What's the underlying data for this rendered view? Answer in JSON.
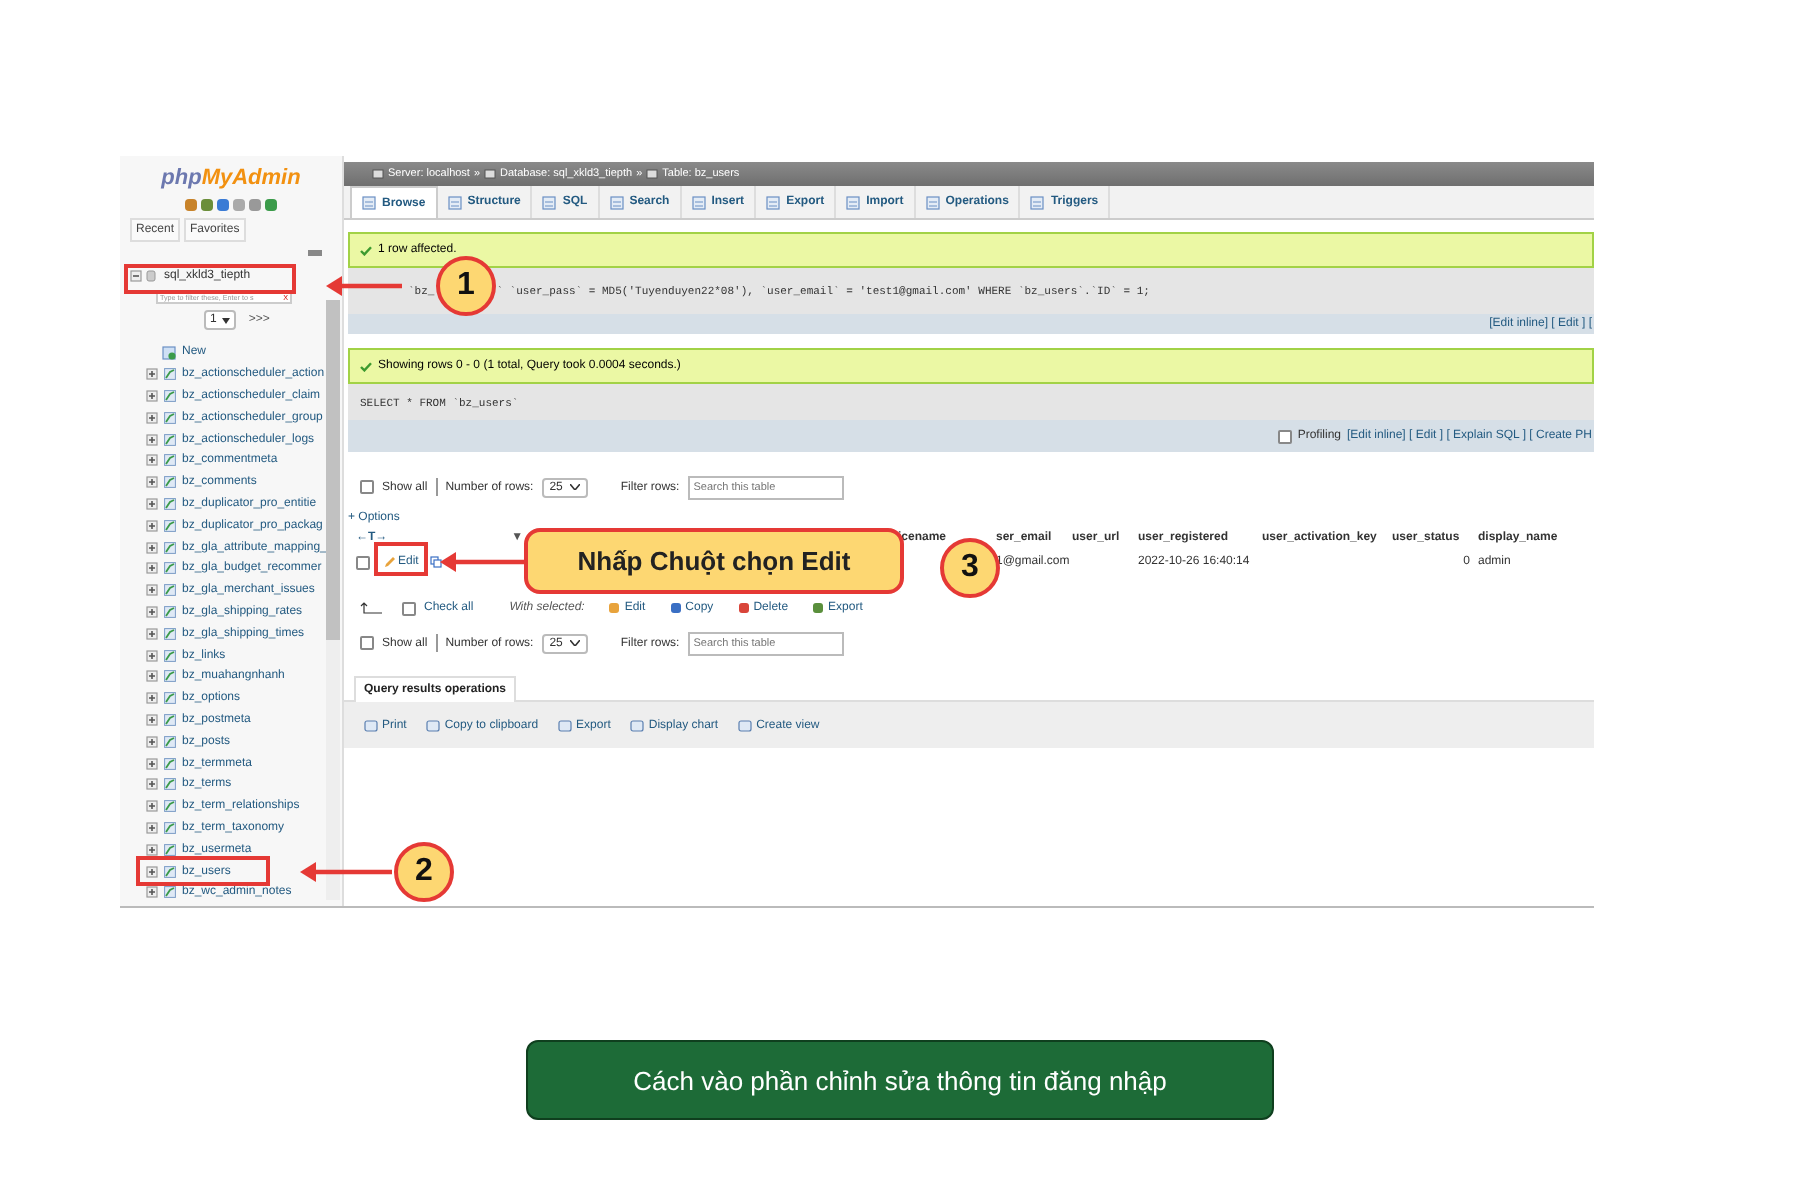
{
  "sidebar": {
    "logo": [
      "php",
      "MyAdmin"
    ],
    "tabs": [
      "Recent",
      "Favorites"
    ],
    "database": "sql_xkld3_tiepth",
    "filter_placeholder": "Type to filter these, Enter to s",
    "filter_clear": "X",
    "page": "1",
    "next": ">>>",
    "new_item": "New",
    "tables": [
      "bz_actionscheduler_action",
      "bz_actionscheduler_claim",
      "bz_actionscheduler_group",
      "bz_actionscheduler_logs",
      "bz_commentmeta",
      "bz_comments",
      "bz_duplicator_pro_entitie",
      "bz_duplicator_pro_packag",
      "bz_gla_attribute_mapping_",
      "bz_gla_budget_recommer",
      "bz_gla_merchant_issues",
      "bz_gla_shipping_rates",
      "bz_gla_shipping_times",
      "bz_links",
      "bz_muahangnhanh",
      "bz_options",
      "bz_postmeta",
      "bz_posts",
      "bz_termmeta",
      "bz_terms",
      "bz_term_relationships",
      "bz_term_taxonomy",
      "bz_usermeta",
      "bz_users",
      "bz_wc_admin_notes"
    ]
  },
  "breadcrumb": [
    {
      "text": "Server: localhost",
      "sep": "»"
    },
    {
      "text": "Database: sql_xkld3_tiepth",
      "sep": "»"
    },
    {
      "text": "Table: bz_users"
    }
  ],
  "tabs": [
    {
      "label": "Browse",
      "selected": true
    },
    {
      "label": "Structure",
      "selected": false
    },
    {
      "label": "SQL",
      "selected": false
    },
    {
      "label": "Search",
      "selected": false
    },
    {
      "label": "Insert",
      "selected": false
    },
    {
      "label": "Export",
      "selected": false
    },
    {
      "label": "Import",
      "selected": false
    },
    {
      "label": "Operations",
      "selected": false
    },
    {
      "label": "Triggers",
      "selected": false
    }
  ],
  "update_result": {
    "message": "1 row affected.",
    "sql_parts": [
      "`bz_",
      "` `user_pass` = MD5('Tuyenduyen22*08'), `user_email` = 'test1@gmail.com' WHERE `bz_users`.`ID` = 1;"
    ],
    "links": "[Edit inline] [ Edit ] ["
  },
  "select_result": {
    "message": "Showing rows 0 - 0 (1 total, Query took 0.0004 seconds.)",
    "sql": "SELECT * FROM `bz_users`",
    "profiling": "Profiling",
    "profiling_checked": false,
    "links": "[Edit inline] [ Edit ] [ Explain SQL ] [ Create PH"
  },
  "navs": [
    {
      "show_all": "Show all",
      "checked": false,
      "rows_label": "Number of rows:",
      "rows": "25",
      "filter_label": "Filter rows:",
      "filter_placeholder": "Search this table"
    },
    {
      "show_all": "Show all",
      "checked": false,
      "rows_label": "Number of rows:",
      "rows": "25",
      "filter_label": "Filter rows:",
      "filter_placeholder": "Search this table"
    }
  ],
  "options": "+ Options",
  "table": {
    "sort_handle": "←T→",
    "sort_arrow": "▼",
    "columns": [
      {
        "label": "icename"
      },
      {
        "label": "ser_email",
        "value": "1@gmail.com"
      },
      {
        "label": "user_url"
      },
      {
        "label": "user_registered",
        "value": "2022-10-26 16:40:14"
      },
      {
        "label": "user_activation_key"
      },
      {
        "label": "user_status",
        "value": "0"
      },
      {
        "label": "display_name",
        "value": "admin"
      }
    ],
    "row": {
      "checked": false,
      "edit": "Edit"
    }
  },
  "check_all": {
    "label": "Check all",
    "checked": false,
    "with_selected": "With selected:",
    "actions": [
      "Edit",
      "Copy",
      "Delete",
      "Export"
    ]
  },
  "query_ops": {
    "title": "Query results operations",
    "actions": [
      "Print",
      "Copy to clipboard",
      "Export",
      "Display chart",
      "Create view"
    ]
  },
  "annotations": {
    "markers": [
      "1",
      "2",
      "3"
    ],
    "callout": "Nhấp Chuột chọn Edit"
  },
  "caption": "Cách vào phần chỉnh sửa thông tin đăng nhập"
}
